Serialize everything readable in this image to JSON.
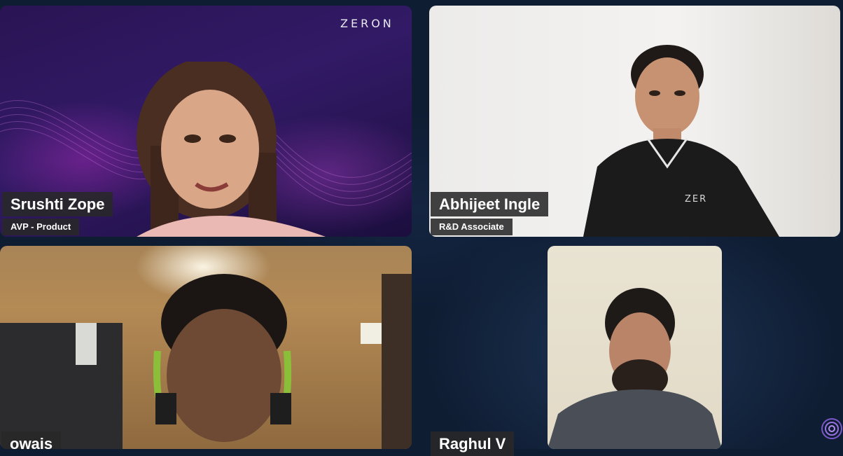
{
  "brand": {
    "logo_text": "ZERON"
  },
  "participants": [
    {
      "name": "Srushti Zope",
      "role": "AVP - Product"
    },
    {
      "name": "Abhijeet Ingle",
      "role": "R&D Associate"
    },
    {
      "name": "owais"
    },
    {
      "name": "Raghul V"
    }
  ],
  "colors": {
    "background": "#0f1d33",
    "name_plate": "#2a2a2a",
    "tile1_background": "#2a1454"
  },
  "icons": {
    "corner_logo": "fingerprint-icon"
  }
}
